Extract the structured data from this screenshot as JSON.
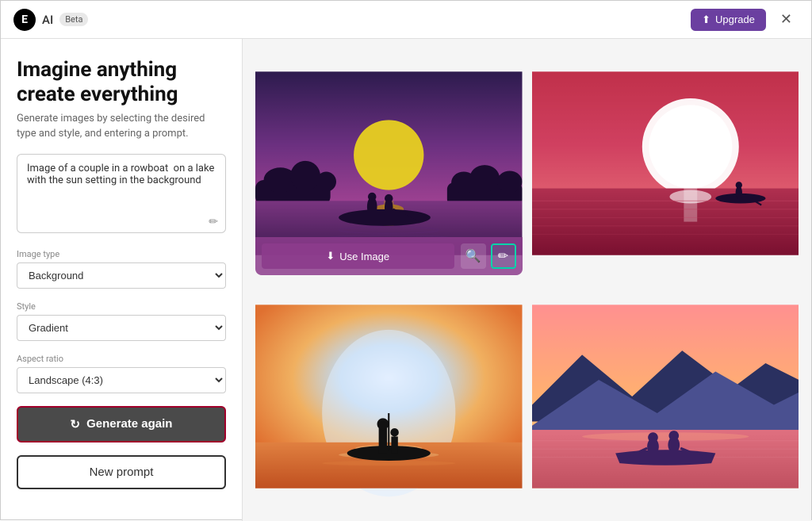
{
  "topbar": {
    "logo_letter": "E",
    "logo_text": "AI",
    "beta_label": "Beta",
    "upgrade_label": "Upgrade",
    "close_label": "✕"
  },
  "left_panel": {
    "title": "Imagine anything\ncreate everything",
    "subtitle": "Generate images by selecting the desired type and style, and entering a prompt.",
    "prompt_value": "Image of a couple in a rowboat  on a lake with the sun setting in the background",
    "image_type_label": "Image type",
    "image_type_value": "Background",
    "style_label": "Style",
    "style_value": "Gradient",
    "aspect_ratio_label": "Aspect ratio",
    "aspect_ratio_value": "Landscape (4:3)",
    "generate_btn_label": "Generate again",
    "new_prompt_btn_label": "New prompt"
  },
  "images": [
    {
      "id": 1,
      "position": "top-left",
      "use_image_label": "Use Image",
      "has_overlay": true
    },
    {
      "id": 2,
      "position": "top-right",
      "has_overlay": false
    },
    {
      "id": 3,
      "position": "bottom-left",
      "has_overlay": false
    },
    {
      "id": 4,
      "position": "bottom-right",
      "has_overlay": false
    }
  ],
  "colors": {
    "accent": "#6b3fa0",
    "border_highlight": "#00d4aa",
    "generate_border": "#a0002a"
  }
}
